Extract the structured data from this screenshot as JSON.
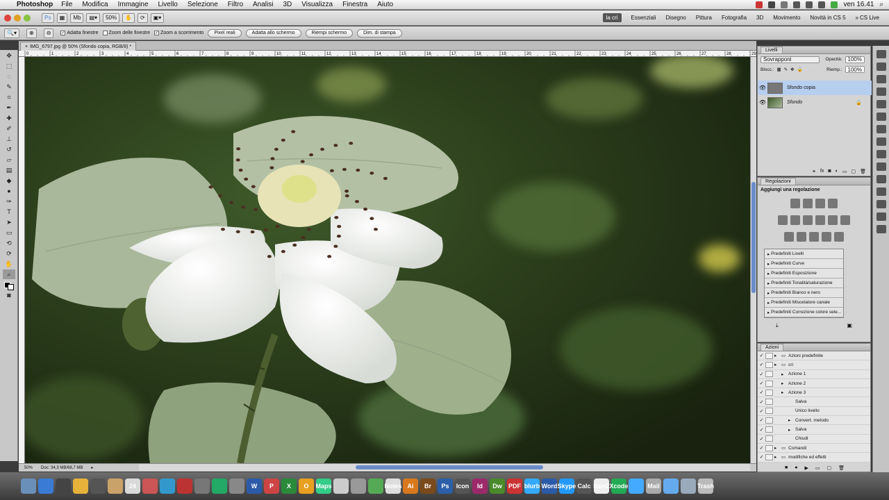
{
  "menubar": {
    "app_name": "Photoshop",
    "items": [
      "File",
      "Modifica",
      "Immagine",
      "Livello",
      "Selezione",
      "Filtro",
      "Analisi",
      "3D",
      "Visualizza",
      "Finestra",
      "Aiuto"
    ],
    "clock": "ven 16.41"
  },
  "appbar": {
    "zoom": "50%",
    "ps_label": "Ps",
    "mb_label": "Mb",
    "workspaces": [
      "la cri",
      "Essenziali",
      "Disegno",
      "Pittura",
      "Fotografia",
      "3D",
      "Movimento",
      "Novità in CS 5"
    ],
    "cs_live": "CS Live"
  },
  "options": {
    "adatta_finestre": "Adatta finestre",
    "zoom_finestre": "Zoom delle finestre",
    "zoom_scorrimento": "Zoom a scorrimento",
    "buttons": [
      "Pixel reali",
      "Adatta allo schermo",
      "Riempi schermo",
      "Dim. di stampa"
    ]
  },
  "document": {
    "tab_title": "IMG_6797.jpg @ 50% (Sfondo copia, RGB/8) *",
    "ruler_ticks": [
      "0",
      "1",
      "2",
      "3",
      "4",
      "5",
      "6",
      "7",
      "8",
      "9",
      "10",
      "11",
      "12",
      "13",
      "14",
      "15",
      "16",
      "17",
      "18",
      "19",
      "20",
      "21",
      "22",
      "23",
      "24",
      "25",
      "26",
      "27",
      "28",
      "29"
    ],
    "status_zoom": "50%",
    "status_doc": "Doc: 34,3 MB/68,7 MB"
  },
  "layers": {
    "title": "Livelli",
    "blend_mode": "Sovrapponi",
    "opacity_label": "Opacità:",
    "opacity": "100%",
    "lock_label": "Blocc.:",
    "fill_label": "Riemp.:",
    "fill": "100%",
    "items": [
      "Sfondo copia",
      "Sfondo"
    ]
  },
  "adjustments": {
    "title": "Regolazioni",
    "subtitle": "Aggiungi una regolazione",
    "presets": [
      "Predefiniti Livelli",
      "Predefiniti Curve",
      "Predefiniti Esposizione",
      "Predefiniti Tonalità/saturazione",
      "Predefiniti Bianco e nero",
      "Predefiniti Miscelatore canale",
      "Predefiniti Correzione colore sele..."
    ]
  },
  "actions": {
    "title": "Azioni",
    "items": [
      {
        "label": "Azioni predefinite",
        "indent": 0,
        "folder": true
      },
      {
        "label": "cri",
        "indent": 0,
        "folder": true
      },
      {
        "label": "Azione 1",
        "indent": 1,
        "folder": false
      },
      {
        "label": "Azione 2",
        "indent": 1,
        "folder": false
      },
      {
        "label": "Azione 3",
        "indent": 1,
        "folder": false
      },
      {
        "label": "Salva",
        "indent": 2,
        "folder": false
      },
      {
        "label": "Unico livello",
        "indent": 2,
        "folder": false
      },
      {
        "label": "Convert. metodo",
        "indent": 2,
        "folder": false
      },
      {
        "label": "Salva",
        "indent": 2,
        "folder": false
      },
      {
        "label": "Chiudi",
        "indent": 2,
        "folder": false
      },
      {
        "label": "Comandi",
        "indent": 0,
        "folder": true
      },
      {
        "label": "modifiche ed effetti",
        "indent": 0,
        "folder": true
      }
    ]
  },
  "dock": {
    "items": [
      "Finder",
      "Safari",
      "Dashboard",
      "Chrome",
      "FaceTime",
      "Contacts",
      "24",
      "iPhoto",
      "iTunes",
      "Photo Booth",
      "Scripts",
      "Time Machine",
      "Sys Prefs",
      "W",
      "P",
      "X",
      "O",
      "Maps",
      "Preview",
      "Pencil",
      "Numbers",
      "Notes",
      "Ai",
      "Br",
      "Ps",
      "Icon",
      "Id",
      "Dw",
      "PDF",
      "blurb",
      "Word",
      "Skype",
      "Calc",
      "Icon2",
      "Xcode",
      "Dropbox",
      "Mail",
      "Folder",
      "Downloads",
      "Trash"
    ]
  },
  "colors": {
    "canvas_dark": "#1f2a14",
    "leaf": "#a9b89a",
    "petal": "#f2f3f0",
    "accent_blue": "#6a8cc9"
  }
}
